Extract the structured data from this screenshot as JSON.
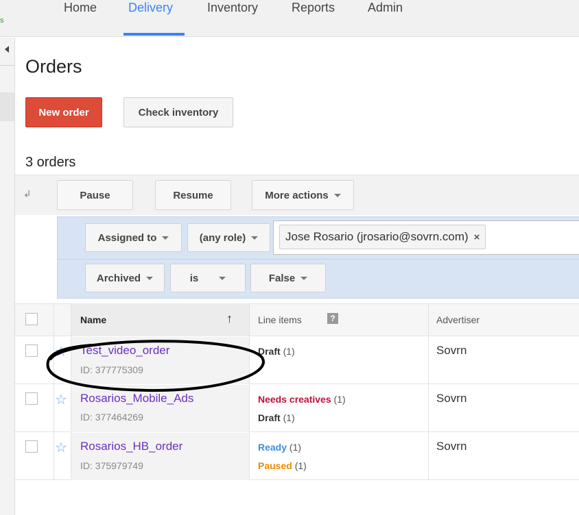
{
  "nav": {
    "logo_fragment": "s",
    "tabs": [
      "Home",
      "Delivery",
      "Inventory",
      "Reports",
      "Admin"
    ],
    "active_tab": "Delivery"
  },
  "page": {
    "title": "Orders",
    "new_order_label": "New order",
    "check_inventory_label": "Check inventory",
    "count_label": "3 orders"
  },
  "toolbar": {
    "pause_label": "Pause",
    "resume_label": "Resume",
    "more_actions_label": "More actions"
  },
  "filters": {
    "assigned_to_label": "Assigned to",
    "role_label": "(any role)",
    "token_value": "Jose Rosario (jrosario@sovrn.com)",
    "archived_label": "Archived",
    "operator_label": "is",
    "value_label": "False"
  },
  "table": {
    "columns": {
      "name": "Name",
      "line_items": "Line items",
      "advertiser": "Advertiser"
    },
    "help_icon_text": "?",
    "rows": [
      {
        "name": "Test_video_order",
        "id": "ID: 377775309",
        "line_items": [
          {
            "status": "Draft",
            "count": "(1)",
            "color": "#333333"
          }
        ],
        "advertiser": "Sovrn"
      },
      {
        "name": "Rosarios_Mobile_Ads",
        "id": "ID: 377464269",
        "line_items": [
          {
            "status": "Needs creatives",
            "count": "(1)",
            "color": "#c0103a"
          },
          {
            "status": "Draft",
            "count": "(1)",
            "color": "#333333"
          }
        ],
        "advertiser": "Sovrn"
      },
      {
        "name": "Rosarios_HB_order",
        "id": "ID: 375979749",
        "line_items": [
          {
            "status": "Ready",
            "count": "(1)",
            "color": "#3b8fe0"
          },
          {
            "status": "Paused",
            "count": "(1)",
            "color": "#f08a00"
          }
        ],
        "advertiser": "Sovrn"
      }
    ]
  },
  "colors": {
    "accent_blue": "#3b82f6",
    "primary_red": "#dd4b39",
    "link_purple": "#6b2fbe",
    "filter_bg": "#d8e4f4"
  },
  "icons": {
    "sort": "arrow-up-icon",
    "star": "star-outline-icon",
    "collapse": "collapse-left-icon",
    "refresh": "refresh-icon",
    "remove": "close-icon",
    "help": "help-icon"
  }
}
